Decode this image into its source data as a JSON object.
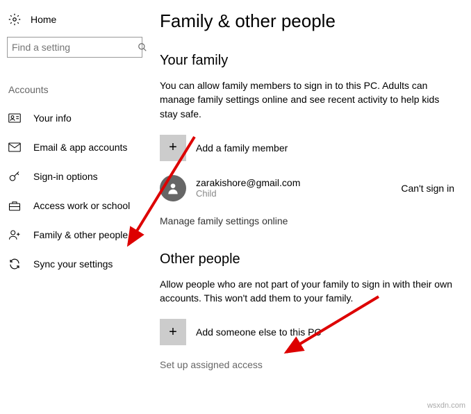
{
  "sidebar": {
    "home_label": "Home",
    "search_placeholder": "Find a setting",
    "section_label": "Accounts",
    "items": [
      {
        "label": "Your info"
      },
      {
        "label": "Email & app accounts"
      },
      {
        "label": "Sign-in options"
      },
      {
        "label": "Access work or school"
      },
      {
        "label": "Family & other people"
      },
      {
        "label": "Sync your settings"
      }
    ]
  },
  "main": {
    "title": "Family & other people",
    "family": {
      "heading": "Your family",
      "desc": "You can allow family members to sign in to this PC. Adults can manage family settings online and see recent activity to help kids stay safe.",
      "add_label": "Add a family member",
      "member": {
        "email": "zarakishore@gmail.com",
        "role": "Child",
        "status": "Can't sign in"
      },
      "manage_link": "Manage family settings online"
    },
    "other": {
      "heading": "Other people",
      "desc": "Allow people who are not part of your family to sign in with their own accounts. This won't add them to your family.",
      "add_label": "Add someone else to this PC",
      "setup_link": "Set up assigned access"
    }
  },
  "watermark": "wsxdn.com"
}
